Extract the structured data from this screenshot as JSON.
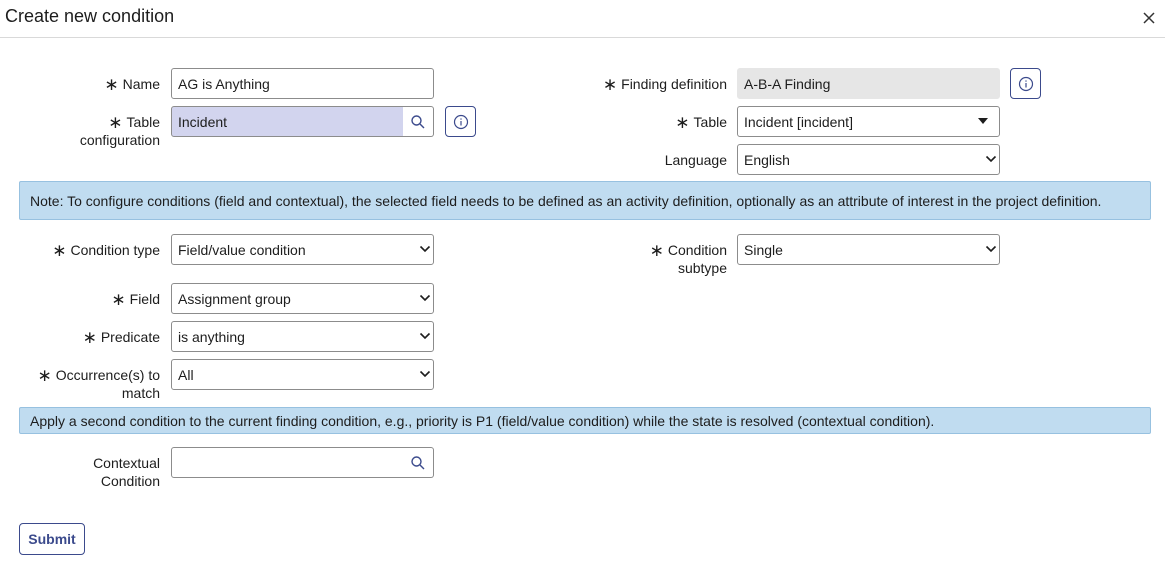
{
  "dialog": {
    "title": "Create new condition",
    "close_icon": "close-icon"
  },
  "form": {
    "name": {
      "label": "Name",
      "value": "AG is Anything"
    },
    "table_configuration": {
      "label_line1": "Table",
      "label_line2": "configuration",
      "value": "Incident"
    },
    "finding_definition": {
      "label": "Finding definition",
      "value": "A-B-A Finding"
    },
    "table": {
      "label": "Table",
      "value": "Incident [incident]"
    },
    "language": {
      "label": "Language",
      "value": "English"
    },
    "note1": "Note: To configure conditions (field and contextual), the selected field needs to be defined as an activity definition, optionally as an attribute of interest in the project definition.",
    "condition_type": {
      "label": "Condition type",
      "value": "Field/value condition"
    },
    "condition_subtype": {
      "label_line1": "Condition",
      "label_line2": "subtype",
      "value": "Single"
    },
    "field": {
      "label": "Field",
      "value": "Assignment group"
    },
    "predicate": {
      "label": "Predicate",
      "value": "is anything"
    },
    "occurrences": {
      "label_line1": "Occurrence(s) to",
      "label_line2": "match",
      "value": "All"
    },
    "note2": "Apply a second condition to the current finding condition, e.g., priority is P1 (field/value condition) while the state is resolved (contextual condition).",
    "contextual_condition": {
      "label_line1": "Contextual",
      "label_line2": "Condition",
      "value": ""
    },
    "submit_label": "Submit",
    "required_mark": "∗"
  },
  "colors": {
    "accent": "#3b4a8c",
    "note_bg": "#c0dcf0",
    "highlight_bg": "#d2d4ee",
    "readonly_bg": "#e6e6e6"
  }
}
